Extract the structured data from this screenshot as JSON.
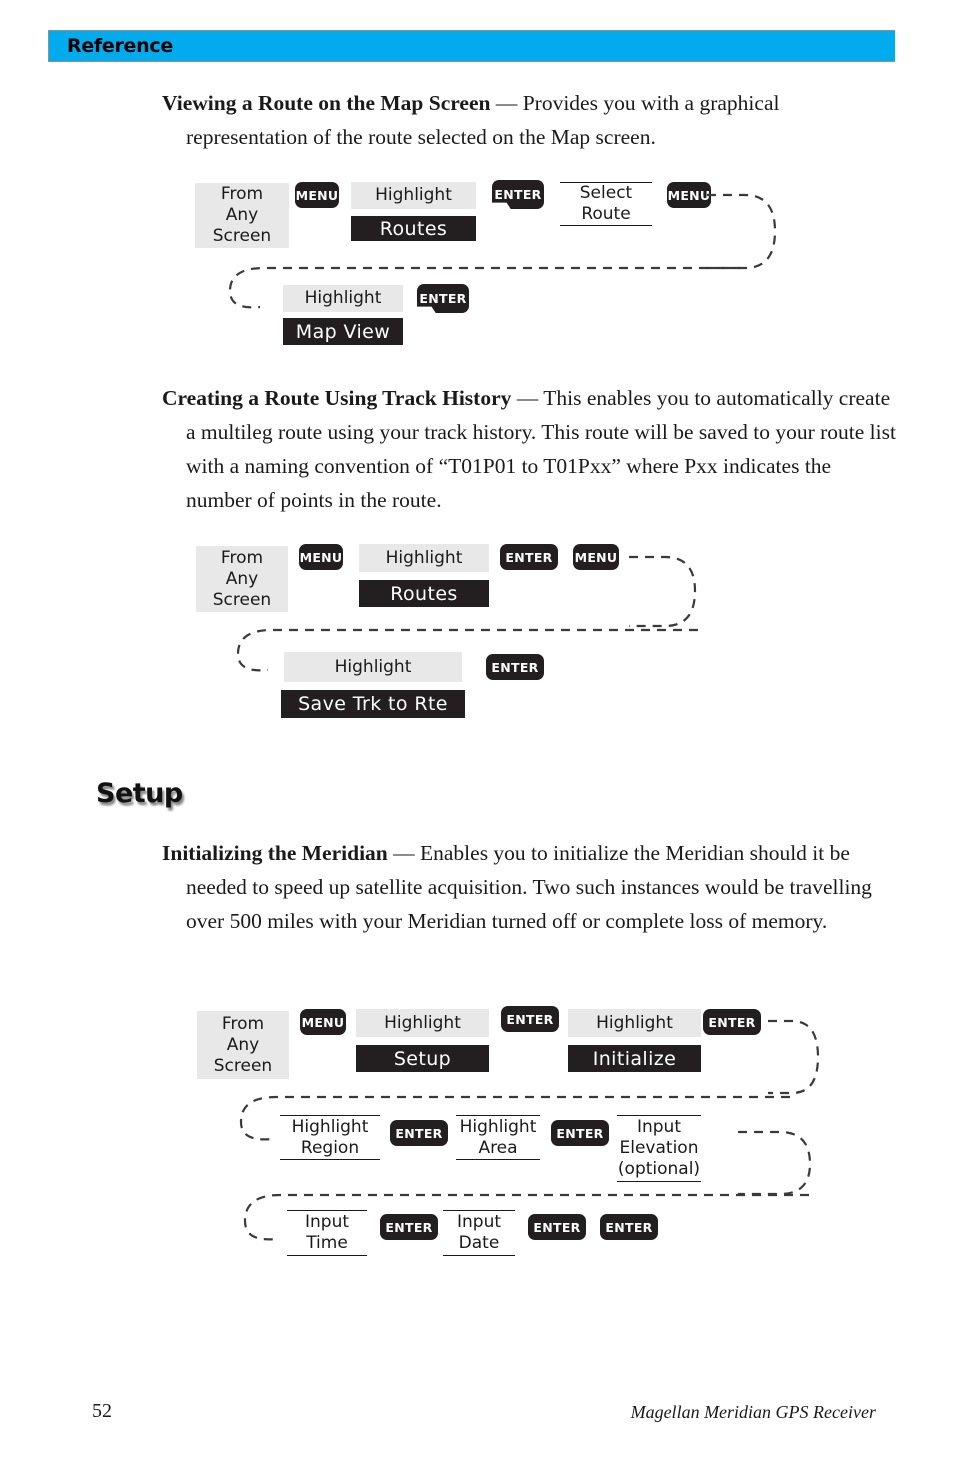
{
  "header": {
    "title": "Reference"
  },
  "sections": [
    {
      "id": "viewing-route",
      "lead": "Viewing a Route on the Map Screen",
      "dash": " — ",
      "body": "Provides you with a graphical representation of the route selected on the Map screen."
    },
    {
      "id": "creating-route",
      "lead": "Creating a Route Using Track History",
      "dash": " —  ",
      "body": "This enables you to automatically create a multileg route using your track history.  This route will be saved to your route list with a naming convention of “T01P01 to T01Pxx” where Pxx indicates the number of points in the route."
    },
    {
      "id": "initializing-meridian",
      "lead": "Initializing the Meridian",
      "dash": " — ",
      "body": "Enables you to initialize the Meridian should it be needed to speed up satellite acquisition.  Two such instances would be travelling over 500 miles with your Meridian turned off or complete loss of memory."
    }
  ],
  "setup_banner": {
    "label": "Setup"
  },
  "diagrams": {
    "viewing_route": {
      "start": "From\nAny\nScreen",
      "keys": {
        "menu": "MENU",
        "enter": "ENTER"
      },
      "nodes": {
        "highlight_1": "Highlight",
        "routes": "Routes",
        "select_route": "Select\nRoute",
        "highlight_2": "Highlight",
        "map_view": "Map View"
      }
    },
    "creating_route": {
      "start": "From\nAny\nScreen",
      "keys": {
        "menu": "MENU",
        "enter": "ENTER"
      },
      "nodes": {
        "highlight_1": "Highlight",
        "routes": "Routes",
        "highlight_2": "Highlight",
        "save_trk": "Save Trk to Rte"
      }
    },
    "initializing": {
      "start": "From\nAny\nScreen",
      "keys": {
        "menu": "MENU",
        "enter": "ENTER"
      },
      "nodes": {
        "highlight_1": "Highlight",
        "setup": "Setup",
        "highlight_2": "Highlight",
        "initialize": "Initialize",
        "highlight_region": "Highlight\nRegion",
        "highlight_area": "Highlight\nArea",
        "input_elevation": "Input\nElevation\n(optional)",
        "input_time": "Input\nTime",
        "input_date": "Input\nDate"
      }
    }
  },
  "footer": {
    "page_number": "52",
    "product": "Magellan Meridian GPS Receiver"
  },
  "colors": {
    "header_blue": "#00acee",
    "plate_black": "#231f20",
    "plate_grey": "#e8e8e8"
  }
}
